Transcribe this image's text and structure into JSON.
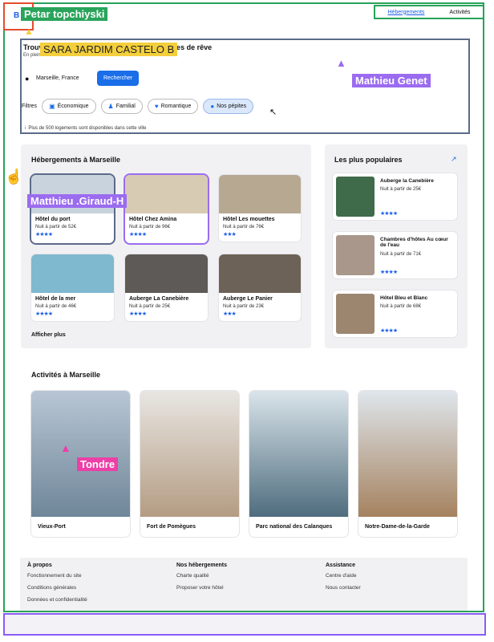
{
  "header": {
    "logo": "B",
    "nav": [
      "Hébergements",
      "Activités"
    ]
  },
  "annotations": {
    "petar": "Petar topchiyski",
    "sara": "SARA JARDIM CASTELO B",
    "mathieu_genet": "Mathieu Genet",
    "matthieu_giraud": "Matthieu .Giraud-H",
    "tondre": "Tondre"
  },
  "hero": {
    "title": "Trouvez votre hébergement pour des vacances de rêve",
    "subtitle": "En plein cœur de Marseille",
    "city": "Marseille, France",
    "search_button": "Rechercher",
    "filters_label": "Filtres",
    "filters": [
      {
        "label": "Économique",
        "icon": "money-icon"
      },
      {
        "label": "Familial",
        "icon": "person-icon"
      },
      {
        "label": "Romantique",
        "icon": "heart-icon"
      },
      {
        "label": "Nos pépites",
        "icon": "flame-icon"
      }
    ],
    "availability": "Plus de 500 logements sont disponibles dans cette ville"
  },
  "hebergements": {
    "title": "Hébergements à Marseille",
    "items": [
      {
        "name": "Hôtel du port",
        "price": "Nuit à partir de 52€",
        "stars": "★★★★",
        "color": "#c9d3de"
      },
      {
        "name": "Hôtel Chez Amina",
        "price": "Nuit à partir de 96€",
        "stars": "★★★★",
        "color": "#d8cbb4"
      },
      {
        "name": "Hôtel Les mouettes",
        "price": "Nuit à partir de 76€",
        "stars": "★★★",
        "color": "#b7a892"
      },
      {
        "name": "Hôtel de la mer",
        "price": "Nuit à partir de 46€",
        "stars": "★★★★",
        "color": "#7fb9cf"
      },
      {
        "name": "Auberge La Canebière",
        "price": "Nuit à partir de 25€",
        "stars": "★★★★",
        "color": "#5e5a57"
      },
      {
        "name": "Auberge Le Panier",
        "price": "Nuit à partir de 23€",
        "stars": "★★★",
        "color": "#6d6257"
      }
    ],
    "show_more": "Afficher plus"
  },
  "populaires": {
    "title": "Les plus populaires",
    "items": [
      {
        "name": "Auberge la Canebière",
        "price": "Nuit à partir de 25€",
        "stars": "★★★★",
        "color": "#3f6b4b"
      },
      {
        "name": "Chambres d'hôtes Au cœur de l'eau",
        "price": "Nuit à partir de 71€",
        "stars": "★★★★",
        "color": "#a8978a"
      },
      {
        "name": "Hôtel Bleu et Blanc",
        "price": "Nuit à partir de 68€",
        "stars": "★★★★",
        "color": "#9c8670"
      }
    ]
  },
  "activites": {
    "title": "Activités à Marseille",
    "items": [
      {
        "name": "Vieux-Port",
        "color": "#8da0b2"
      },
      {
        "name": "Fort de Pomègues",
        "color": "#c9b8a5"
      },
      {
        "name": "Parc national des Calanques",
        "color": "#5f7d8e"
      },
      {
        "name": "Notre-Dame-de-la-Garde",
        "color": "#b09476"
      }
    ]
  },
  "footer": {
    "cols": [
      {
        "title": "À propos",
        "links": [
          "Fonctionnement du site",
          "Conditions générales",
          "Données et confidentialité"
        ]
      },
      {
        "title": "Nos hébergements",
        "links": [
          "Charte qualité",
          "Proposer votre hôtel"
        ]
      },
      {
        "title": "Assistance",
        "links": [
          "Centre d'aide",
          "Nous contacter"
        ]
      }
    ]
  }
}
